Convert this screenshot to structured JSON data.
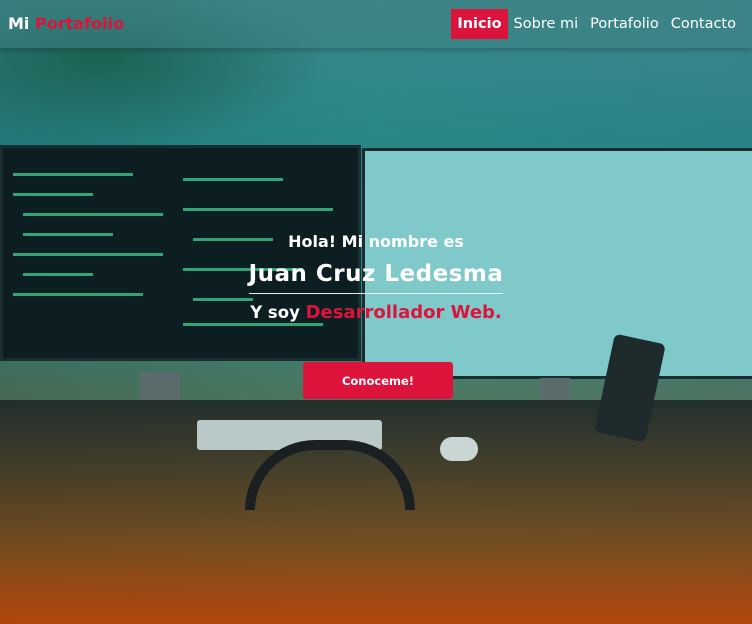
{
  "brand": {
    "first": "Mi",
    "accent": "Portafolio"
  },
  "nav": {
    "items": [
      {
        "label": "Inicio",
        "active": true
      },
      {
        "label": "Sobre mi",
        "active": false
      },
      {
        "label": "Portafolio",
        "active": false
      },
      {
        "label": "Contacto",
        "active": false
      }
    ]
  },
  "hero": {
    "greeting": "Hola! Mi nombre es",
    "name": "Juan Cruz Ledesma",
    "role_prefix": "Y soy",
    "role_highlight": "Desarrollador Web.",
    "cta_label": "Conoceme!"
  },
  "colors": {
    "accent": "#dc143c",
    "text": "#ffffff"
  },
  "icons": []
}
